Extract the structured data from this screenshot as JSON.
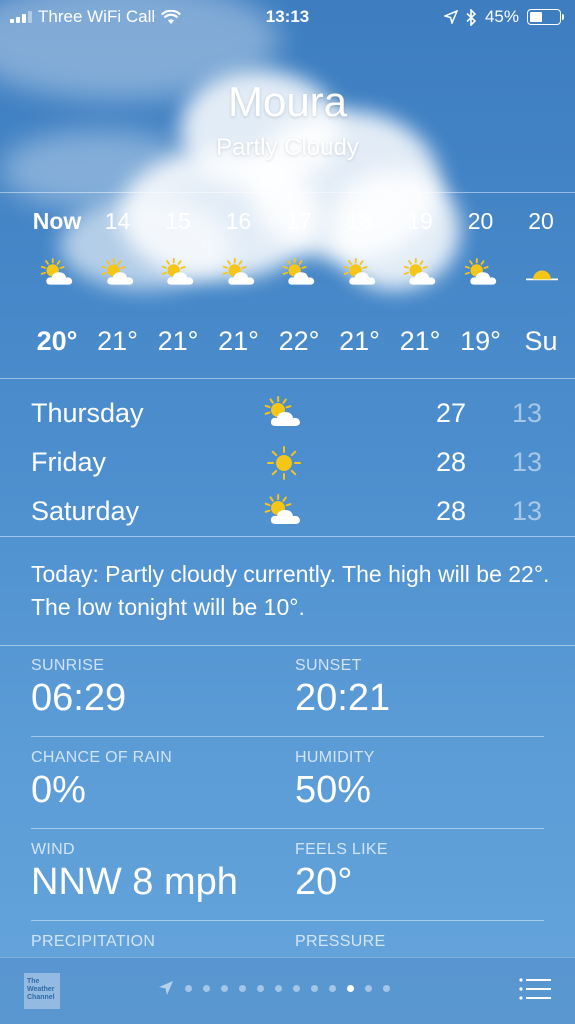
{
  "status": {
    "carrier": "Three WiFi Call",
    "time": "13:13",
    "battery": "45%",
    "battery_level": 0.45
  },
  "location": {
    "city": "Moura",
    "condition": "Partly Cloudy"
  },
  "hourly": [
    {
      "label": "Now",
      "temp": "20°",
      "icon": "partly-sunny-icon"
    },
    {
      "label": "14",
      "temp": "21°",
      "icon": "partly-sunny-icon"
    },
    {
      "label": "15",
      "temp": "21°",
      "icon": "partly-sunny-icon"
    },
    {
      "label": "16",
      "temp": "21°",
      "icon": "partly-sunny-icon"
    },
    {
      "label": "17",
      "temp": "22°",
      "icon": "partly-sunny-icon"
    },
    {
      "label": "18",
      "temp": "21°",
      "icon": "partly-sunny-icon"
    },
    {
      "label": "19",
      "temp": "21°",
      "icon": "partly-sunny-icon"
    },
    {
      "label": "20",
      "temp": "19°",
      "icon": "partly-sunny-icon"
    },
    {
      "label": "20",
      "temp": "Su",
      "icon": "sunset-icon"
    }
  ],
  "daily": [
    {
      "day": "Thursday",
      "high": "27",
      "low": "13",
      "icon": "partly-sunny-icon"
    },
    {
      "day": "Friday",
      "high": "28",
      "low": "13",
      "icon": "sunny-icon"
    },
    {
      "day": "Saturday",
      "high": "28",
      "low": "13",
      "icon": "partly-sunny-icon"
    }
  ],
  "summary": "Today: Partly cloudy currently. The high will be 22°. The low tonight will be 10°.",
  "details": {
    "sunrise": {
      "label": "SUNRISE",
      "value": "06:29"
    },
    "sunset": {
      "label": "SUNSET",
      "value": "20:21"
    },
    "chance_of_rain": {
      "label": "CHANCE OF RAIN",
      "value": "0%"
    },
    "humidity": {
      "label": "HUMIDITY",
      "value": "50%"
    },
    "wind": {
      "label": "WIND",
      "value": "NNW 8 mph"
    },
    "feels_like": {
      "label": "FEELS LIKE",
      "value": "20°"
    },
    "precipitation": {
      "label": "PRECIPITATION"
    },
    "pressure": {
      "label": "PRESSURE"
    }
  },
  "bottom_bar": {
    "weather_channel_logo": "The Weather Channel",
    "page_count": 12,
    "active_page": 10
  },
  "colors": {
    "sun": "#f5c518",
    "cloud": "#ffffff",
    "sky_top": "#3d7dc0",
    "sky_bottom": "#66a5dc"
  }
}
